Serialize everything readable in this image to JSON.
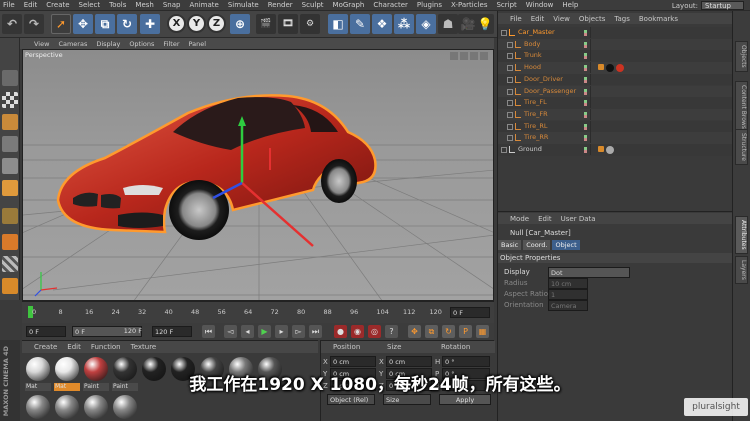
{
  "menubar": {
    "items": [
      "File",
      "Edit",
      "Create",
      "Select",
      "Tools",
      "Mesh",
      "Snap",
      "Animate",
      "Simulate",
      "Render",
      "Sculpt",
      "MoGraph",
      "Character",
      "Plugins",
      "X-Particles",
      "Script",
      "Window",
      "Help"
    ],
    "layout_label": "Layout:",
    "layout_value": "Startup"
  },
  "toolbar": {
    "axis_x": "X",
    "axis_y": "Y",
    "axis_z": "Z"
  },
  "viewport": {
    "menu": [
      "View",
      "Cameras",
      "Display",
      "Options",
      "Filter",
      "Panel"
    ],
    "camera_label": "Perspective"
  },
  "timeline": {
    "ticks": [
      "0",
      "8",
      "16",
      "24",
      "32",
      "40",
      "48",
      "56",
      "64",
      "72",
      "80",
      "88",
      "96",
      "104",
      "112",
      "120"
    ],
    "end_field": "0 F"
  },
  "playback": {
    "start": "0 F",
    "min": "0 F",
    "max": "120 F",
    "end": "120 F"
  },
  "materials": {
    "menu": [
      "Create",
      "Edit",
      "Function",
      "Texture"
    ],
    "items": [
      {
        "label": "Mat",
        "color": "#d8d8d8"
      },
      {
        "label": "Mat",
        "color": "#e8e8e8"
      },
      {
        "label": "Paint",
        "color": "#c04040"
      },
      {
        "label": "Paint",
        "color": "#333333"
      },
      {
        "label": "",
        "color": "#222222"
      },
      {
        "label": "",
        "color": "#222222"
      },
      {
        "label": "",
        "color": "#444444"
      },
      {
        "label": "",
        "color": "#777777"
      },
      {
        "label": "",
        "color": "#555555"
      }
    ]
  },
  "coordinates": {
    "headers": [
      "Position",
      "Size",
      "Rotation"
    ],
    "rows": [
      {
        "axis": "X",
        "pos": "0 cm",
        "axis2": "X",
        "size": "0 cm",
        "rot_axis": "H",
        "rot": "0 °"
      },
      {
        "axis": "Y",
        "pos": "0 cm",
        "axis2": "Y",
        "size": "0 cm",
        "rot_axis": "P",
        "rot": "0 °"
      },
      {
        "axis": "Z",
        "pos": "0 cm",
        "axis2": "Z",
        "size": "0 cm",
        "rot_axis": "B",
        "rot": "0 °"
      }
    ],
    "mode": "Object (Rel)",
    "size_mode": "Size",
    "apply": "Apply"
  },
  "object_manager": {
    "menu": [
      "File",
      "Edit",
      "View",
      "Objects",
      "Tags",
      "Bookmarks"
    ],
    "objects": [
      {
        "name": "Car_Master",
        "color": "#ff9a2e",
        "indent": 0
      },
      {
        "name": "Body",
        "color": "#d7893a",
        "indent": 1
      },
      {
        "name": "Trunk",
        "color": "#d7893a",
        "indent": 1
      },
      {
        "name": "Hood",
        "color": "#d7893a",
        "indent": 1
      },
      {
        "name": "Door_Driver",
        "color": "#d7893a",
        "indent": 1
      },
      {
        "name": "Door_Passenger",
        "color": "#d7893a",
        "indent": 1
      },
      {
        "name": "Tire_FL",
        "color": "#d7893a",
        "indent": 1
      },
      {
        "name": "Tire_FR",
        "color": "#d7893a",
        "indent": 1
      },
      {
        "name": "Tire_RL",
        "color": "#d7893a",
        "indent": 1
      },
      {
        "name": "Tire_RR",
        "color": "#d7893a",
        "indent": 1
      },
      {
        "name": "Ground",
        "color": "#cccccc",
        "indent": 0
      }
    ]
  },
  "attributes": {
    "menu": [
      "Mode",
      "Edit",
      "User Data"
    ],
    "object_title": "Null [Car_Master]",
    "tabs": [
      "Basic",
      "Coord.",
      "Object"
    ],
    "section": "Object Properties",
    "props": [
      {
        "label": "Display",
        "value": "Dot"
      },
      {
        "label": "Radius",
        "value": "10 cm"
      },
      {
        "label": "Aspect Ratio",
        "value": "1"
      },
      {
        "label": "Orientation",
        "value": "Camera"
      }
    ]
  },
  "sidetabs": [
    "Objects",
    "Content Browser",
    "Structure",
    "Attributes",
    "Layers"
  ],
  "brand": {
    "maxon": "MAXON CINEMA 4D",
    "watermark": "pluralsight"
  },
  "subtitle": "我工作在1920 X 1080，每秒24帧，所有这些。"
}
